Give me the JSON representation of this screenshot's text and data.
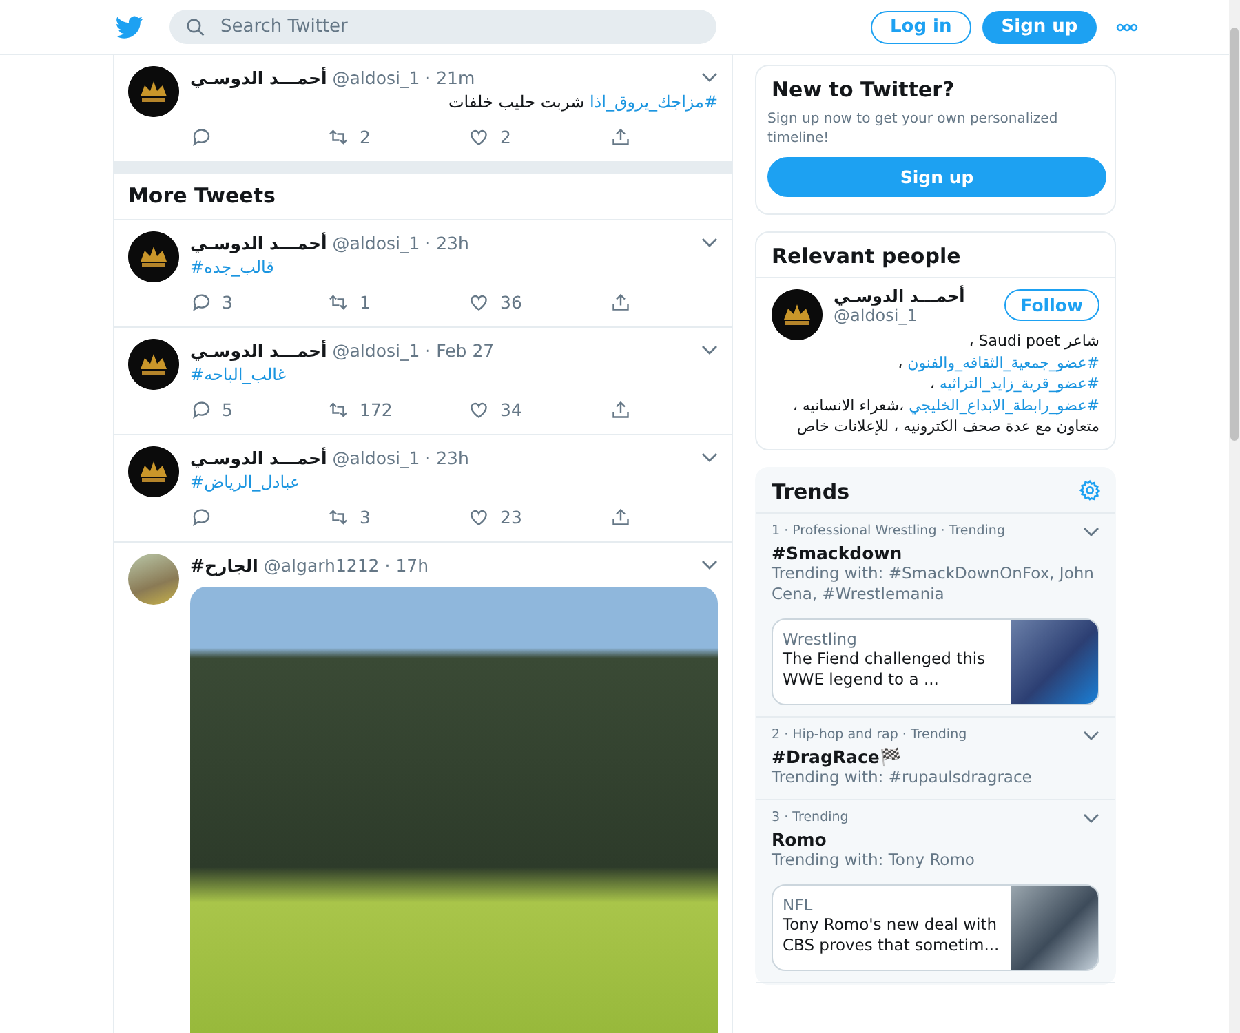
{
  "header": {
    "search": {
      "placeholder": "Search Twitter"
    },
    "login": "Log in",
    "signup": "Sign up"
  },
  "timeline": {
    "tweets": [
      {
        "name": "أحمـــد الدوسـي",
        "handle": "@aldosi_1",
        "time": "· 21m",
        "avatar": {
          "kind": "logo"
        },
        "body": {
          "rtl": true,
          "parts": [
            {
              "kind": "hashtag",
              "text": "#مزاجك_يروق_اذا"
            },
            {
              "kind": "text",
              "text": " شربت حليب خلفات"
            }
          ]
        },
        "retweets": "2",
        "likes": "2"
      }
    ],
    "section_title": "More Tweets",
    "more_tweets": [
      {
        "name": "أحمـــد الدوسـي",
        "handle": "@aldosi_1",
        "time": "· 23h",
        "avatar": {
          "kind": "logo"
        },
        "body": {
          "rtl": false,
          "parts": [
            {
              "kind": "hashtag",
              "text": "#قالب_جده"
            }
          ]
        },
        "replies": "3",
        "retweets": "1",
        "likes": "36"
      },
      {
        "name": "أحمـــد الدوسـي",
        "handle": "@aldosi_1",
        "time": "· Feb 27",
        "avatar": {
          "kind": "logo"
        },
        "body": {
          "rtl": false,
          "parts": [
            {
              "kind": "hashtag",
              "text": "#غالب_الباحه"
            }
          ]
        },
        "replies": "5",
        "retweets": "172",
        "likes": "34"
      },
      {
        "name": "أحمـــد الدوسـي",
        "handle": "@aldosi_1",
        "time": "· 23h",
        "avatar": {
          "kind": "logo"
        },
        "body": {
          "rtl": false,
          "parts": [
            {
              "kind": "hashtag",
              "text": "#عبادل_الرياض"
            }
          ]
        },
        "retweets": "3",
        "likes": "23"
      },
      {
        "name": "#الجارح",
        "handle": "@algarh1212",
        "time": "· 17h",
        "avatar": {
          "kind": "photo"
        },
        "media": {
          "kind": "video"
        }
      }
    ]
  },
  "sidebar": {
    "new_to_twitter": {
      "title": "New to Twitter?",
      "text": "Sign up now to get your own personalized timeline!",
      "button": "Sign up"
    },
    "relevant_people": {
      "title": "Relevant people",
      "person": {
        "name": "أحمـــد الدوسـي",
        "handle": "@aldosi_1",
        "follow": "Follow",
        "bio": [
          {
            "kind": "text",
            "text": "شاعر Saudi poet ، "
          },
          {
            "kind": "hashtag",
            "text": "#عضو_جمعية_الثقافه_والفنون"
          },
          {
            "kind": "text",
            "text": " ، "
          },
          {
            "kind": "hashtag",
            "text": "#عضو_قرية_زايد_التراثيه"
          },
          {
            "kind": "text",
            "text": " ، "
          },
          {
            "kind": "hashtag",
            "text": "#عضو_رابطة_الابداع_الخليجي"
          },
          {
            "kind": "text",
            "text": " ،شعراء الانسانيه ، متعاون مع عدة صحف الكترونيه ، للإعلانات خاص"
          }
        ]
      }
    },
    "trends": {
      "title": "Trends",
      "items": [
        {
          "meta": "1 · Professional Wrestling · Trending",
          "title": "#Smackdown",
          "with": "Trending with: #SmackDownOnFox, John Cena, #Wrestlemania",
          "card": {
            "category": "Wrestling",
            "headline": "The Fiend challenged this WWE legend to a ..."
          }
        },
        {
          "meta": "2 · Hip-hop and rap · Trending",
          "title": "#DragRace🏁",
          "with": "Trending with: #rupaulsdragrace"
        },
        {
          "meta": "3 · Trending",
          "title": "Romo",
          "with": "Trending with: Tony Romo",
          "card": {
            "category": "NFL",
            "headline": "Tony Romo's new deal with CBS proves that sometim..."
          }
        }
      ]
    }
  }
}
